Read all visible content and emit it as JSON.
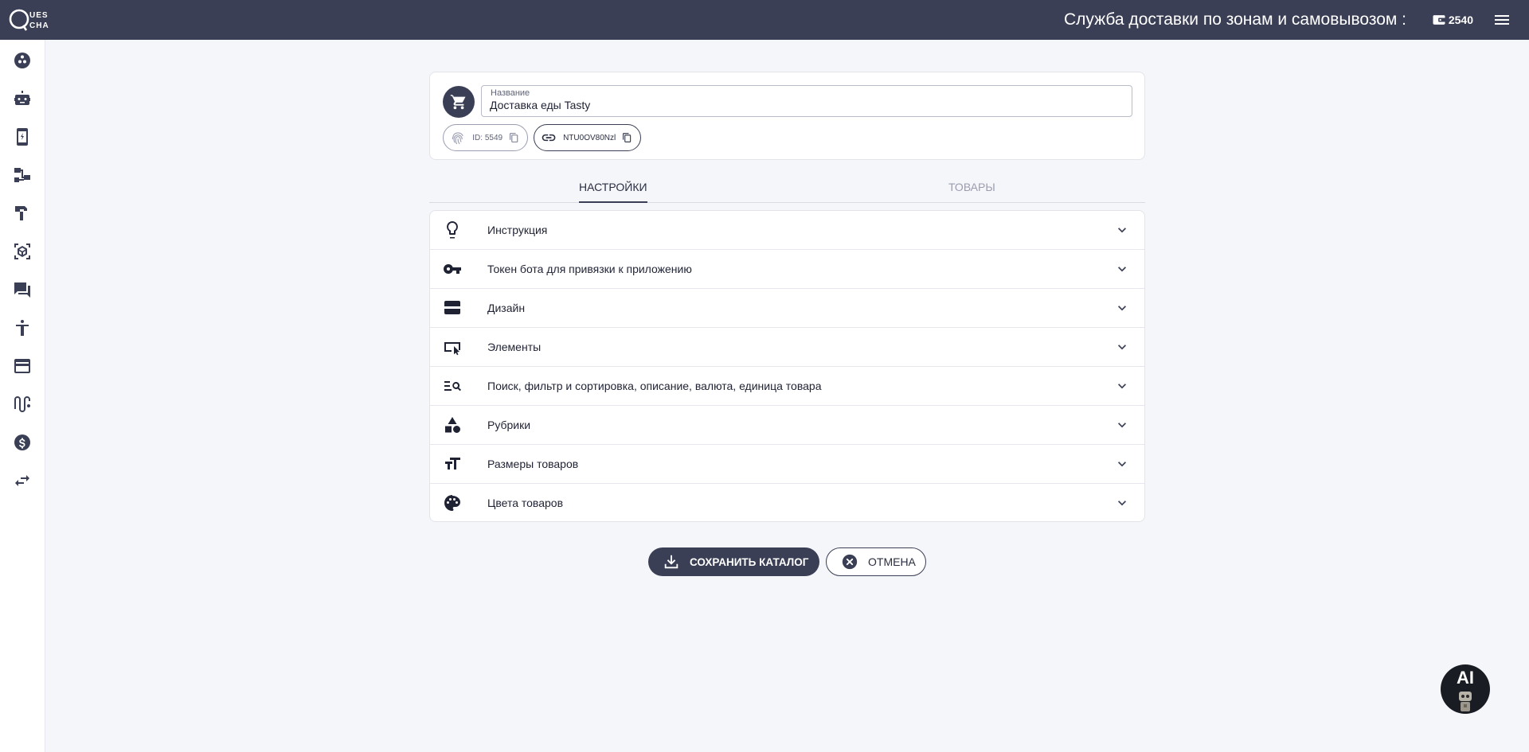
{
  "header": {
    "logo_text": "QUES CHA",
    "title": "Служба доставки по зонам и самовывозом :",
    "balance": "2540",
    "colors": {
      "bar": "#3a3f55",
      "text": "#ffffff"
    }
  },
  "sidebar": {
    "items": [
      {
        "icon": "dashboard-icon"
      },
      {
        "icon": "robot-icon"
      },
      {
        "icon": "mobile-app-icon"
      },
      {
        "icon": "structure-icon"
      },
      {
        "icon": "hammer-icon"
      },
      {
        "icon": "cube-scan-icon"
      },
      {
        "icon": "chat-icon"
      },
      {
        "icon": "accessibility-icon"
      },
      {
        "icon": "credit-card-icon"
      },
      {
        "icon": "route-icon"
      },
      {
        "icon": "dollar-icon"
      },
      {
        "icon": "swap-icon"
      }
    ]
  },
  "catalog": {
    "name_label": "Название",
    "name_value": "Доставка еды Tasty",
    "id_chip": "ID: 5549",
    "link_chip": "NTU0OV80Nzl"
  },
  "tabs": [
    {
      "label": "Настройки",
      "active": true
    },
    {
      "label": "Товары",
      "active": false
    }
  ],
  "sections": [
    {
      "label": "Инструкция",
      "icon": "lightbulb-icon"
    },
    {
      "label": "Токен бота для привязки к приложению",
      "icon": "key-icon"
    },
    {
      "label": "Дизайн",
      "icon": "layout-icon"
    },
    {
      "label": "Элементы",
      "icon": "elements-icon"
    },
    {
      "label": "Поиск, фильтр и сортировка, описание, валюта, единица товара",
      "icon": "search-filter-icon"
    },
    {
      "label": "Рубрики",
      "icon": "categories-icon"
    },
    {
      "label": "Размеры товаров",
      "icon": "text-size-icon"
    },
    {
      "label": "Цвета товаров",
      "icon": "palette-icon"
    }
  ],
  "actions": {
    "save_label": "СОХРАНИТЬ КАТАЛОГ",
    "cancel_label": "ОТМЕНА"
  },
  "assistant": {
    "label": "AI"
  }
}
